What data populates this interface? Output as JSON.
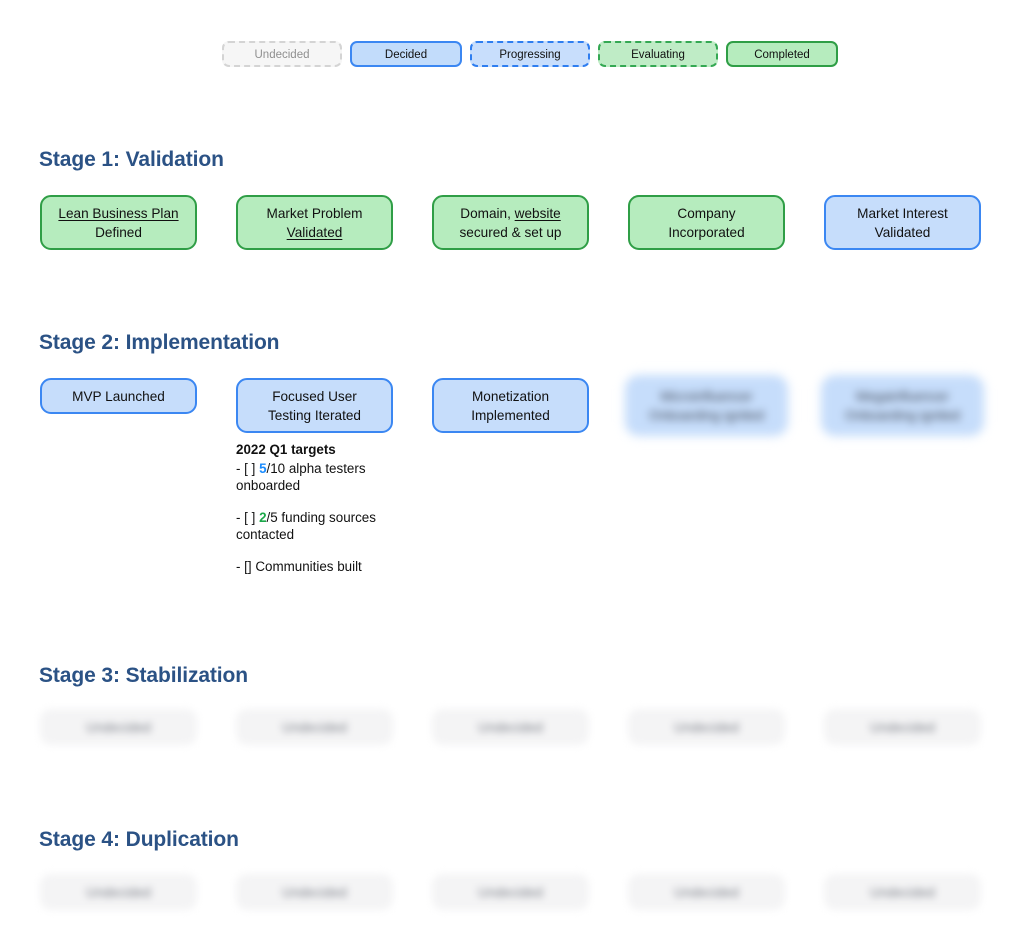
{
  "legend": {
    "items": [
      {
        "label": "Undecided",
        "state": "undecided"
      },
      {
        "label": "Decided",
        "state": "decided"
      },
      {
        "label": "Progressing",
        "state": "progressing"
      },
      {
        "label": "Evaluating",
        "state": "evaluating"
      },
      {
        "label": "Completed",
        "state": "completed"
      }
    ]
  },
  "colors": {
    "heading": "#2b5285",
    "completed_border": "#2f9e46",
    "completed_fill": "#b6ecbe",
    "decided_border": "#3b87f2",
    "decided_fill": "#c6ddfb",
    "undecided_border": "#d4d4d4",
    "undecided_fill": "#f6f6f6",
    "count_blue": "#1a8cff",
    "count_green": "#1ca84a"
  },
  "stages": [
    {
      "title": "Stage 1: Validation",
      "cards": [
        {
          "line1": "Lean Business Plan",
          "line1_underline": true,
          "line2": "Defined",
          "line2_underline": false,
          "state": "completed"
        },
        {
          "line1": "Market Problem",
          "line1_underline": false,
          "line2": "Validated",
          "line2_underline": true,
          "state": "completed"
        },
        {
          "line1": "Domain, website",
          "line1_underline": false,
          "line1_partial_underline": "website",
          "line2": "secured & set up",
          "line2_underline": false,
          "state": "completed"
        },
        {
          "line1": "Company",
          "line1_underline": false,
          "line2": "Incorporated",
          "line2_underline": false,
          "state": "completed"
        },
        {
          "line1": "Market Interest",
          "line1_underline": false,
          "line2": "Validated",
          "line2_underline": false,
          "state": "decided"
        }
      ]
    },
    {
      "title": "Stage 2: Implementation",
      "cards": [
        {
          "line1": "MVP Launched",
          "line2": "",
          "state": "decided",
          "single_line": true
        },
        {
          "line1": "Focused User",
          "line2": "Testing Iterated",
          "state": "decided"
        },
        {
          "line1": "Monetization",
          "line2": "Implemented",
          "state": "decided"
        },
        {
          "line1": "Microinfluencer",
          "line2": "Onboarding ignited",
          "state": "decided",
          "blurred": true
        },
        {
          "line1": "Megainfluencer",
          "line2": "Onboarding ignited",
          "state": "decided",
          "blurred": true
        }
      ]
    },
    {
      "title": "Stage 3: Stabilization",
      "cards": [
        {
          "line1": "Undecided",
          "line2": "",
          "state": "undecided",
          "blurred": true,
          "single_line": true
        },
        {
          "line1": "Undecided",
          "line2": "",
          "state": "undecided",
          "blurred": true,
          "single_line": true
        },
        {
          "line1": "Undecided",
          "line2": "",
          "state": "undecided",
          "blurred": true,
          "single_line": true
        },
        {
          "line1": "Undecided",
          "line2": "",
          "state": "undecided",
          "blurred": true,
          "single_line": true
        },
        {
          "line1": "Undecided",
          "line2": "",
          "state": "undecided",
          "blurred": true,
          "single_line": true
        }
      ]
    },
    {
      "title": "Stage 4: Duplication",
      "cards": [
        {
          "line1": "Undecided",
          "line2": "",
          "state": "undecided",
          "blurred": true,
          "single_line": true
        },
        {
          "line1": "Undecided",
          "line2": "",
          "state": "undecided",
          "blurred": true,
          "single_line": true
        },
        {
          "line1": "Undecided",
          "line2": "",
          "state": "undecided",
          "blurred": true,
          "single_line": true
        },
        {
          "line1": "Undecided",
          "line2": "",
          "state": "undecided",
          "blurred": true,
          "single_line": true
        },
        {
          "line1": "Undecided",
          "line2": "",
          "state": "undecided",
          "blurred": true,
          "single_line": true
        }
      ]
    }
  ],
  "checklist": {
    "header": "2022 Q1 targets",
    "items": [
      {
        "prefix": "- [ ] ",
        "count": "5",
        "count_color": "blue",
        "rest": "/10 alpha testers onboarded"
      },
      {
        "prefix": "- [ ] ",
        "count": "2",
        "count_color": "green",
        "rest": "/5 funding sources contacted"
      },
      {
        "prefix": "- [] ",
        "count": "",
        "count_color": "none",
        "rest": "Communities built"
      }
    ]
  }
}
